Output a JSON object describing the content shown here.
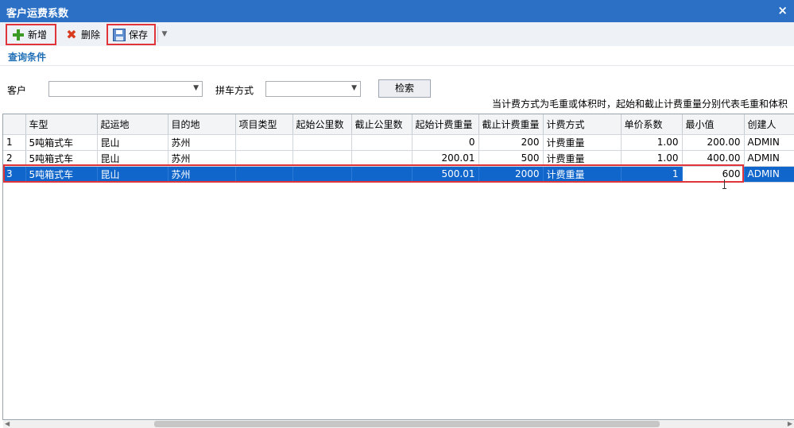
{
  "window": {
    "title": "客户运费系数",
    "close_icon": "×"
  },
  "toolbar": {
    "add_label": "新增",
    "delete_label": "删除",
    "save_label": "保存",
    "dropdown_icon": "▼"
  },
  "query": {
    "section_title": "查询条件",
    "customer_label": "客户",
    "customer_value": "",
    "mode_label": "拼车方式",
    "mode_value": "",
    "search_label": "检索",
    "combo_arrow": "▼"
  },
  "note": "当计费方式为毛重或体积时，起始和截止计费重量分别代表毛重和体积",
  "grid": {
    "columns": [
      "车型",
      "起运地",
      "目的地",
      "项目类型",
      "起始公里数",
      "截止公里数",
      "起始计费重量",
      "截止计费重量",
      "计费方式",
      "单价系数",
      "最小值",
      "创建人"
    ],
    "rows": [
      {
        "idx": "1",
        "cells": [
          "5吨箱式车",
          "昆山",
          "苏州",
          "",
          "",
          "",
          "0",
          "200",
          "计费重量",
          "1.00",
          "200.00",
          "ADMIN"
        ]
      },
      {
        "idx": "2",
        "cells": [
          "5吨箱式车",
          "昆山",
          "苏州",
          "",
          "",
          "",
          "200.01",
          "500",
          "计费重量",
          "1.00",
          "400.00",
          "ADMIN"
        ]
      },
      {
        "idx": "3",
        "cells": [
          "5吨箱式车",
          "昆山",
          "苏州",
          "",
          "",
          "",
          "500.01",
          "2000",
          "计费重量",
          "1",
          "600",
          "ADMIN"
        ]
      }
    ]
  },
  "scroll": {
    "left_arrow": "◀",
    "right_arrow": "▶"
  }
}
